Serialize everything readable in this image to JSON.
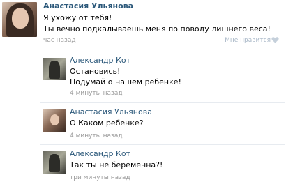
{
  "post": {
    "author": "Анастасия Ульянова",
    "text_line1": "Я ухожу от тебя!",
    "text_line2": "Ты вечно подкалываешь меня по поводу лишнего веса!",
    "time": "час назад",
    "like_label": "Мне нравится"
  },
  "comments": [
    {
      "author": "Александр Кот",
      "text_line1": "Остановись!",
      "text_line2": "Подумай о нашем ребенке!",
      "time": "4 минуты назад"
    },
    {
      "author": "Анастасия Ульянова",
      "text_line1": "О Каком ребенке?",
      "time": "4 минуты назад"
    },
    {
      "author": "Александр Кот",
      "text_line1": "Так ты не беременна?!",
      "time": "три минуты назад"
    }
  ],
  "colors": {
    "name": "#2b587a",
    "meta": "#999999",
    "like": "#a7b6c6"
  }
}
